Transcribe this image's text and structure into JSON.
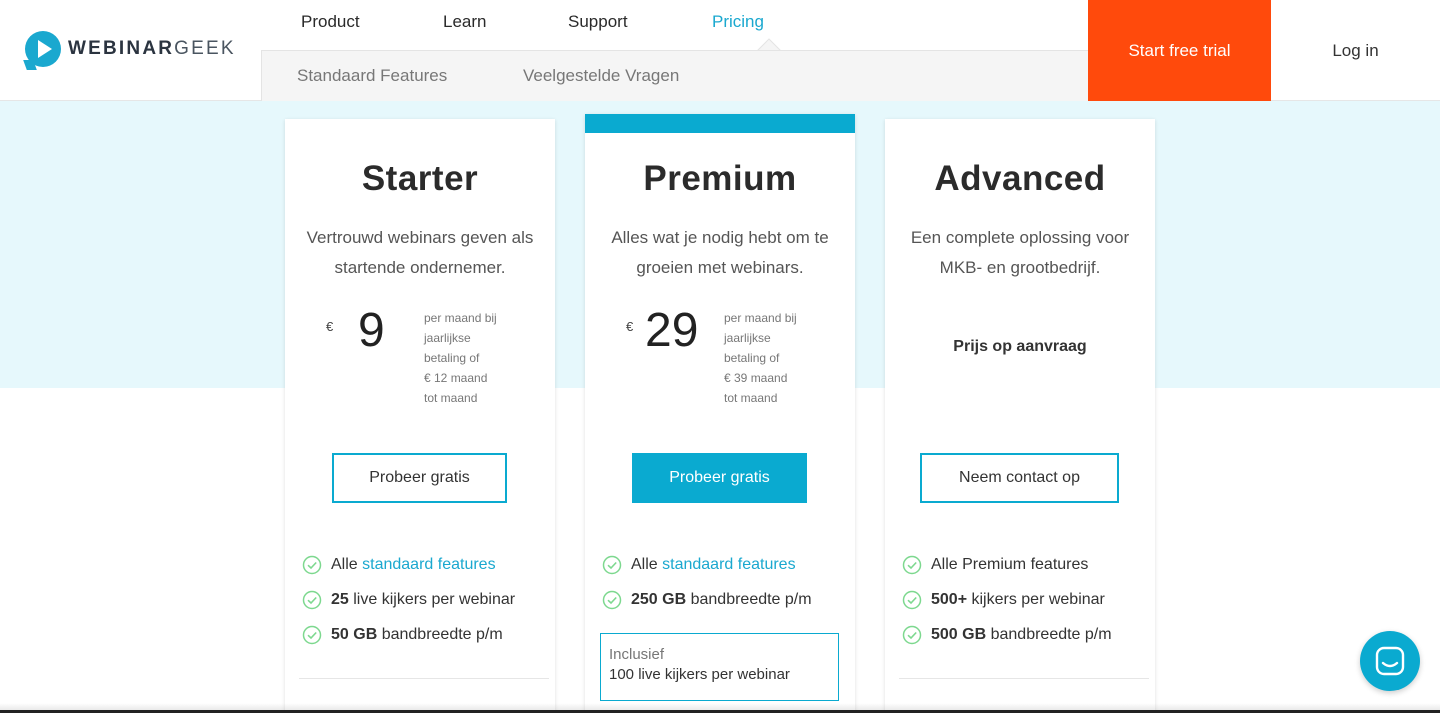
{
  "brand": {
    "name_bold": "WEBINAR",
    "name_light": "GEEK",
    "accent": "#1aa8cf",
    "cta_color": "#ff4a0c"
  },
  "nav": {
    "items": [
      {
        "label": "Product"
      },
      {
        "label": "Learn"
      },
      {
        "label": "Support"
      },
      {
        "label": "Pricing",
        "active": true
      }
    ],
    "sub_items": [
      {
        "label": "Standaard Features"
      },
      {
        "label": "Veelgestelde Vragen"
      }
    ],
    "trial_label": "Start free trial",
    "login_label": "Log in"
  },
  "plans": [
    {
      "title": "Starter",
      "description": "Vertrouwd webinars geven als startende ondernemer.",
      "currency": "€",
      "price": "9",
      "price_note": [
        "per maand bij",
        "jaarlijkse",
        "betaling of",
        "€ 12 maand",
        "tot maand"
      ],
      "cta": "Probeer gratis",
      "features": [
        {
          "prefix": "Alle",
          "link": "standaard features"
        },
        {
          "bold": "25",
          "text": "live kijkers per webinar"
        },
        {
          "bold": "50 GB",
          "text": "bandbreedte p/m"
        }
      ]
    },
    {
      "title": "Premium",
      "description": "Alles wat je nodig hebt om te groeien met webinars.",
      "currency": "€",
      "price": "29",
      "price_note": [
        "per maand bij",
        "jaarlijkse",
        "betaling of",
        "€ 39 maand",
        "tot maand"
      ],
      "cta": "Probeer gratis",
      "features": [
        {
          "prefix": "Alle",
          "link": "standaard features"
        },
        {
          "bold": "250 GB",
          "text": "bandbreedte p/m"
        }
      ],
      "included": {
        "label": "Inclusief",
        "value": "100 live kijkers per webinar"
      }
    },
    {
      "title": "Advanced",
      "description": "Een complete oplossing voor MKB- en grootbedrijf.",
      "price_request": "Prijs op aanvraag",
      "cta": "Neem contact op",
      "features": [
        {
          "text_plain": "Alle Premium features"
        },
        {
          "bold": "500+",
          "text": "kijkers per webinar"
        },
        {
          "bold": "500 GB",
          "text": "bandbreedte p/m"
        }
      ]
    }
  ],
  "icons": {
    "check": "check-circle-icon",
    "chat": "chat-icon"
  }
}
